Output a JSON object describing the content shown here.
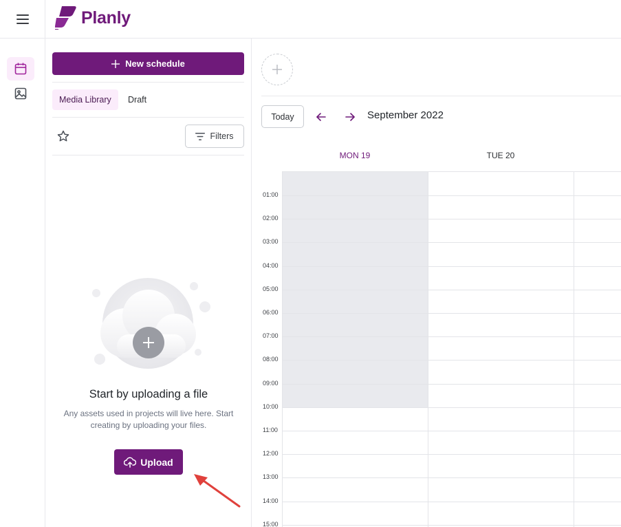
{
  "app": {
    "brand_name": "Planly",
    "brand_color": "#6f1a7a",
    "accent_light": "#fbecfb"
  },
  "rail": {
    "items": [
      {
        "icon": "calendar-icon",
        "active": true
      },
      {
        "icon": "image-icon",
        "active": false
      }
    ]
  },
  "panel": {
    "new_schedule_label": "New schedule",
    "tabs": [
      {
        "label": "Media Library",
        "active": true
      },
      {
        "label": "Draft",
        "active": false
      }
    ],
    "filters_label": "Filters",
    "empty_title": "Start by uploading a file",
    "empty_subtitle": "Any assets used in projects will live here. Start creating by uploading your files.",
    "upload_label": "Upload"
  },
  "calendar": {
    "today_label": "Today",
    "month_label": "September 2022",
    "days": [
      {
        "label": "MON 19",
        "current": true
      },
      {
        "label": "TUE 20",
        "current": false
      }
    ],
    "hours": [
      "01:00",
      "02:00",
      "03:00",
      "04:00",
      "05:00",
      "06:00",
      "07:00",
      "08:00",
      "09:00",
      "10:00",
      "11:00",
      "12:00",
      "13:00",
      "14:00",
      "15:00"
    ]
  }
}
